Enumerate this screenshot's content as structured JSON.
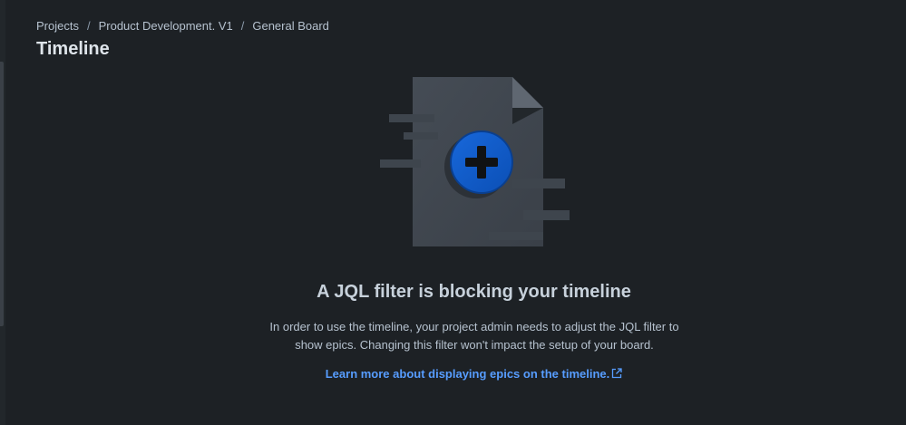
{
  "breadcrumb": {
    "items": [
      "Projects",
      "Product Development. V1",
      "General Board"
    ],
    "separator": "/"
  },
  "page": {
    "title": "Timeline"
  },
  "empty_state": {
    "illustration": "document-plus-icon",
    "heading": "A JQL filter is blocking your timeline",
    "body": "In order to use the timeline, your project admin needs to adjust the JQL filter to show epics. Changing this filter won't impact the setup of your board.",
    "link_label": "Learn more about displaying epics on the timeline.",
    "link_icon": "external-link-icon"
  },
  "colors": {
    "background": "#1d2125",
    "text": "#b6c2cf",
    "heading": "#c7d1db",
    "link": "#579dff",
    "accent": "#0c66e4"
  }
}
